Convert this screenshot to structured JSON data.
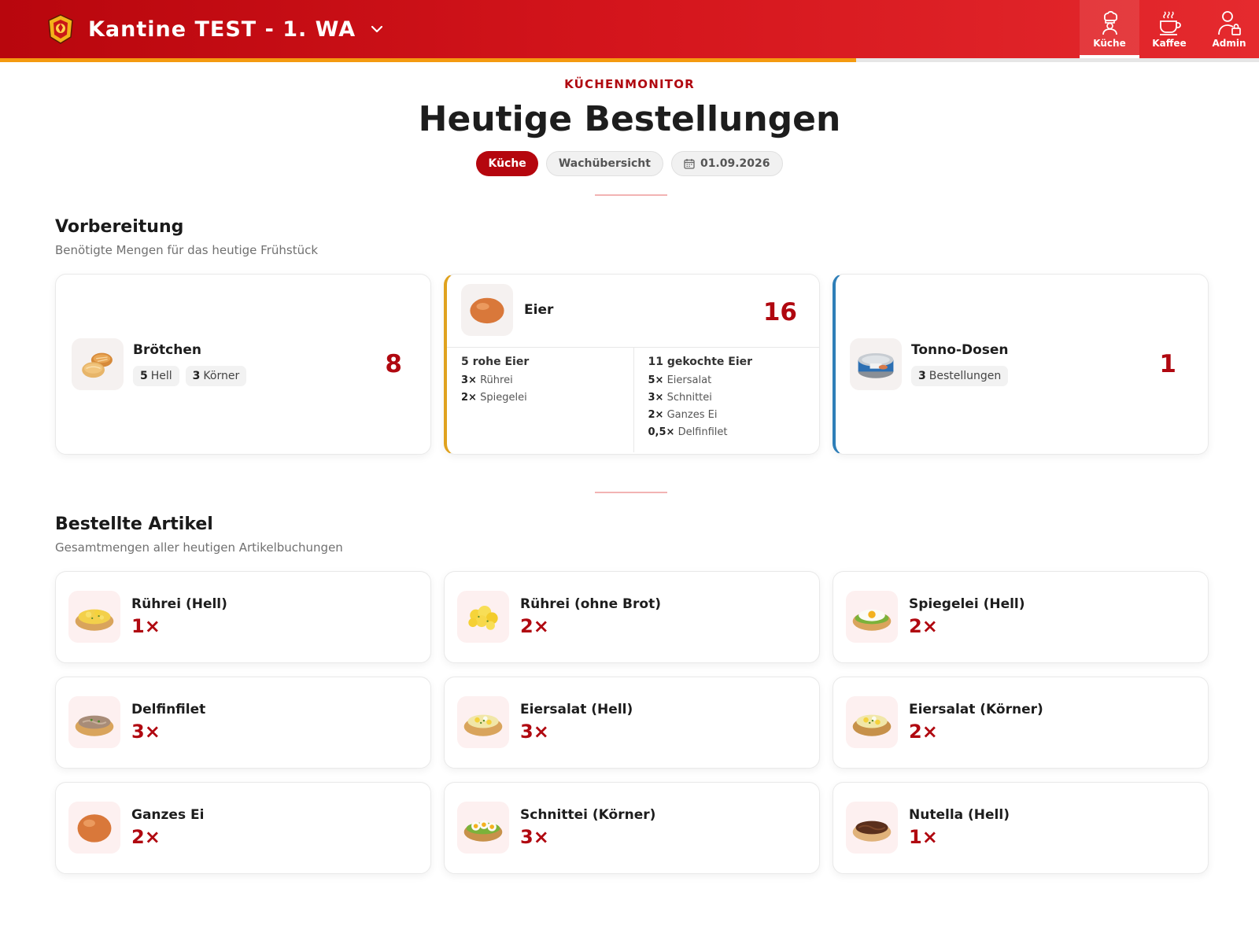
{
  "header": {
    "title": "Kantine TEST - 1. WA",
    "logo_icon": "fire-brigade-emblem-icon",
    "progress_percent": 68,
    "nav": [
      {
        "label": "Küche",
        "icon": "chef-icon",
        "active": true
      },
      {
        "label": "Kaffee",
        "icon": "coffee-icon",
        "active": false
      },
      {
        "label": "Admin",
        "icon": "admin-lock-icon",
        "active": false
      }
    ]
  },
  "hero": {
    "eyebrow": "KÜCHENMONITOR",
    "title": "Heutige Bestellungen",
    "chips": [
      {
        "label": "Küche",
        "active": true
      },
      {
        "label": "Wachübersicht",
        "active": false
      },
      {
        "label": "01.09.2026",
        "icon": "calendar-icon",
        "active": false
      }
    ]
  },
  "prep": {
    "title": "Vorbereitung",
    "subtitle": "Benötigte Mengen für das heutige Frühstück",
    "broetchen": {
      "name": "Brötchen",
      "total": "8",
      "tags": [
        {
          "count": "5",
          "label": "Hell"
        },
        {
          "count": "3",
          "label": "Körner"
        }
      ]
    },
    "eier": {
      "name": "Eier",
      "total": "16",
      "raw_title": "5 rohe Eier",
      "raw_lines": [
        {
          "qty": "3×",
          "label": "Rührei"
        },
        {
          "qty": "2×",
          "label": "Spiegelei"
        }
      ],
      "boiled_title": "11 gekochte Eier",
      "boiled_lines": [
        {
          "qty": "5×",
          "label": "Eiersalat"
        },
        {
          "qty": "3×",
          "label": "Schnittei"
        },
        {
          "qty": "2×",
          "label": "Ganzes Ei"
        },
        {
          "qty": "0,5×",
          "label": "Delfinfilet"
        }
      ],
      "accent_color": "#e0a21e"
    },
    "tonno": {
      "name": "Tonno-Dosen",
      "total": "1",
      "tag_count": "3",
      "tag_label": "Bestellungen",
      "accent_color": "#2f7fb8"
    }
  },
  "articles": {
    "title": "Bestellte Artikel",
    "subtitle": "Gesamtmengen aller heutigen Artikelbuchungen",
    "items": [
      {
        "name": "Rührei (Hell)",
        "qty": "1×",
        "icon": "scrambled-egg-roll-icon"
      },
      {
        "name": "Rührei (ohne Brot)",
        "qty": "2×",
        "icon": "scrambled-egg-icon"
      },
      {
        "name": "Spiegelei (Hell)",
        "qty": "2×",
        "icon": "fried-egg-roll-icon"
      },
      {
        "name": "Delfinfilet",
        "qty": "3×",
        "icon": "tuna-roll-icon"
      },
      {
        "name": "Eiersalat (Hell)",
        "qty": "3×",
        "icon": "egg-salad-roll-icon"
      },
      {
        "name": "Eiersalat (Körner)",
        "qty": "2×",
        "icon": "egg-salad-roll-icon"
      },
      {
        "name": "Ganzes Ei",
        "qty": "2×",
        "icon": "egg-icon"
      },
      {
        "name": "Schnittei (Körner)",
        "qty": "3×",
        "icon": "sliced-egg-roll-icon"
      },
      {
        "name": "Nutella (Hell)",
        "qty": "1×",
        "icon": "nutella-roll-icon"
      }
    ]
  },
  "colors": {
    "brand_red": "#b5060e",
    "accent_red": "#b00810",
    "progress_orange": "#f49a10"
  }
}
